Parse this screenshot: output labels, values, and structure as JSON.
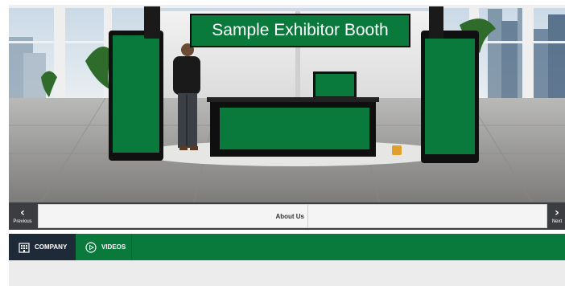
{
  "booth": {
    "title": "Sample Exhibitor Booth",
    "accent_color": "#0a7a3c"
  },
  "nav": {
    "previous_label": "Previous",
    "next_label": "Next",
    "previous_icon": "chevron-left-icon",
    "next_icon": "chevron-right-icon"
  },
  "tabs": [
    {
      "label": "About Us"
    },
    {
      "label": ""
    }
  ],
  "menu": {
    "items": [
      {
        "label": "COMPANY",
        "icon": "building-icon",
        "active": true
      },
      {
        "label": "VIDEOS",
        "icon": "play-circle-icon",
        "active": false
      }
    ],
    "bar_color": "#0a7a3c",
    "active_color": "#1f2a38"
  }
}
